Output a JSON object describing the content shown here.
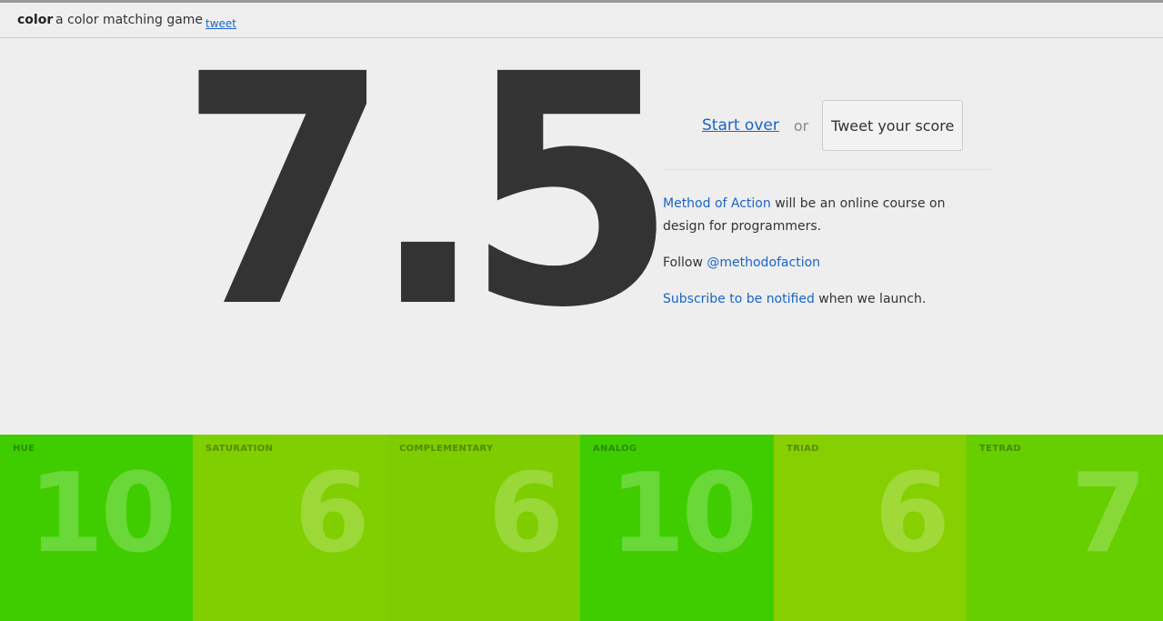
{
  "header": {
    "brand": "color",
    "tagline": "a color matching game",
    "tweet_link": "tweet"
  },
  "score": {
    "value": "7.5"
  },
  "actions": {
    "start_over": "Start over",
    "or": "or",
    "tweet_score": "Tweet your score"
  },
  "info": {
    "p1_link": "Method of Action",
    "p1_text": " will be an online course on design for programmers.",
    "p2_text": "Follow ",
    "p2_link": "@methodofaction",
    "p3_link": "Subscribe to be notified",
    "p3_text": " when we launch."
  },
  "tiles": [
    {
      "label": "HUE",
      "value": "10",
      "color": "#3fcd00"
    },
    {
      "label": "SATURATION",
      "value": "6",
      "color": "#80cf00"
    },
    {
      "label": "COMPLEMENTARY",
      "value": "6",
      "color": "#7dcd00"
    },
    {
      "label": "ANALOG",
      "value": "10",
      "color": "#3fcd00"
    },
    {
      "label": "TRIAD",
      "value": "6",
      "color": "#86cf00"
    },
    {
      "label": "TETRAD",
      "value": "7",
      "color": "#66cf00"
    }
  ],
  "colors": {
    "link": "#1a64c8",
    "score_text": "#333333",
    "background": "#eeeeee"
  }
}
